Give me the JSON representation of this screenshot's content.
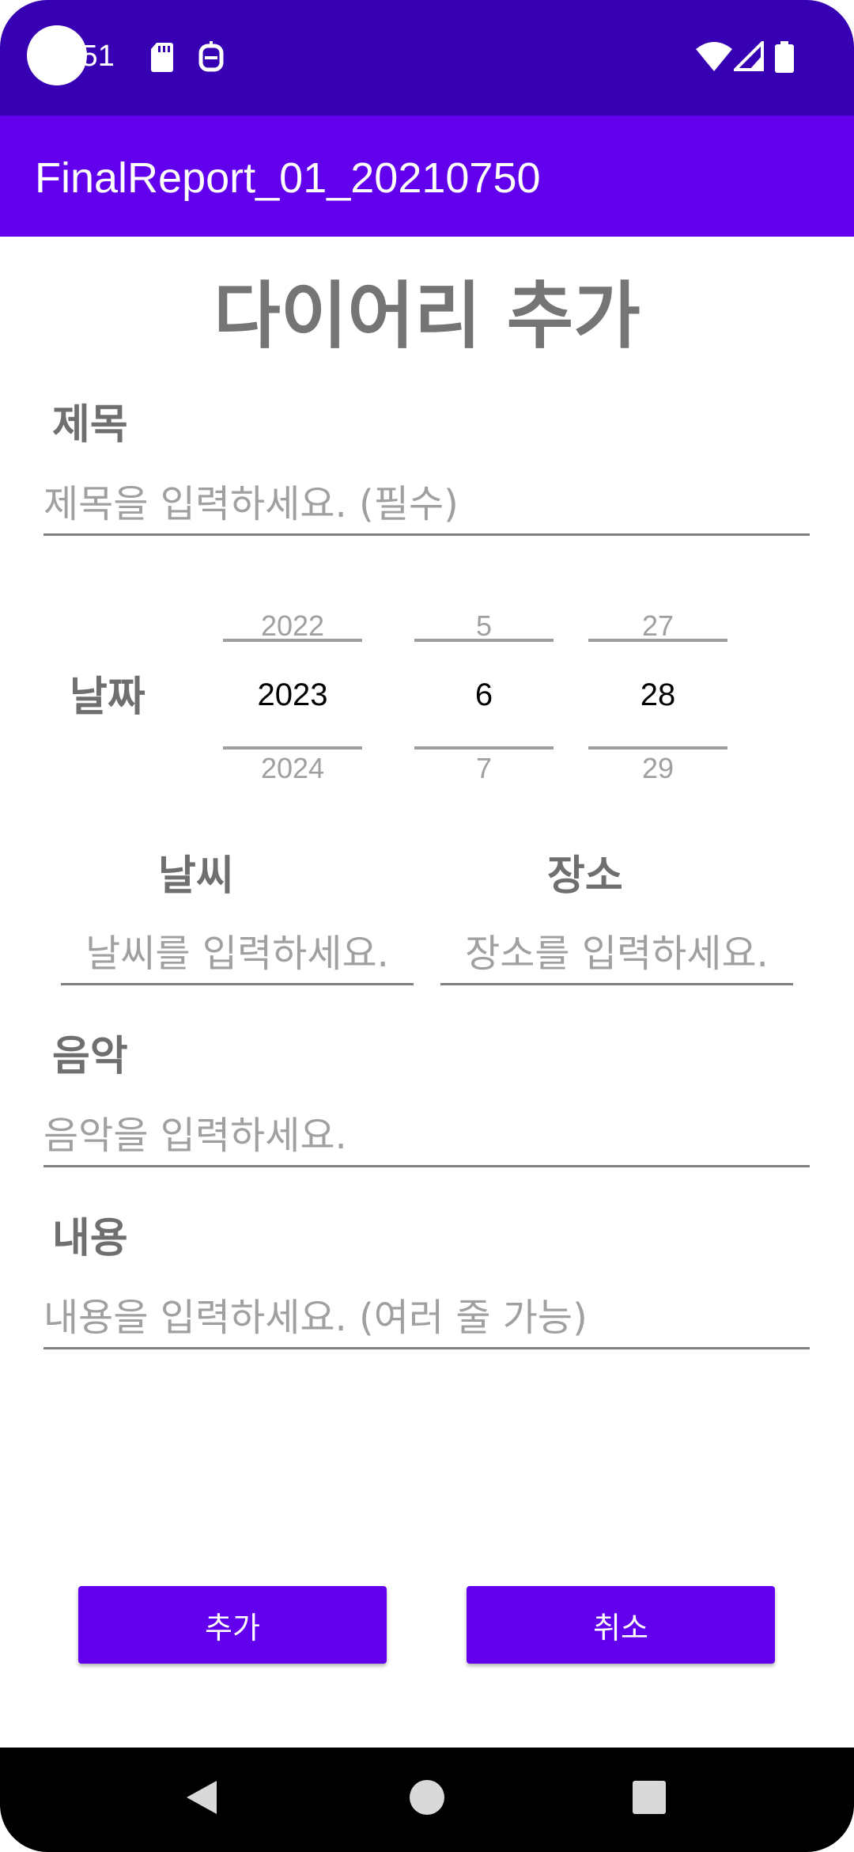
{
  "status_bar": {
    "time": ":51",
    "icons": [
      "sd-card-icon",
      "notification-icon",
      "wifi-icon",
      "signal-icon",
      "battery-icon"
    ]
  },
  "app_bar": {
    "title": "FinalReport_01_20210750"
  },
  "page": {
    "title": "다이어리 추가"
  },
  "form": {
    "title": {
      "label": "제목",
      "placeholder": "제목을 입력하세요. (필수)"
    },
    "date": {
      "label": "날짜",
      "year": {
        "prev": "2022",
        "selected": "2023",
        "next": "2024"
      },
      "month": {
        "prev": "5",
        "selected": "6",
        "next": "7"
      },
      "day": {
        "prev": "27",
        "selected": "28",
        "next": "29"
      }
    },
    "weather": {
      "label": "날씨",
      "placeholder": "날씨를 입력하세요."
    },
    "place": {
      "label": "장소",
      "placeholder": "장소를 입력하세요."
    },
    "music": {
      "label": "음악",
      "placeholder": "음악을 입력하세요."
    },
    "content": {
      "label": "내용",
      "placeholder": "내용을 입력하세요. (여러 줄 가능)"
    }
  },
  "buttons": {
    "add": "추가",
    "cancel": "취소"
  },
  "colors": {
    "status_bar": "#3700b3",
    "primary": "#6200ee",
    "label": "#6f6f6f",
    "hint": "#a0a0a0"
  }
}
